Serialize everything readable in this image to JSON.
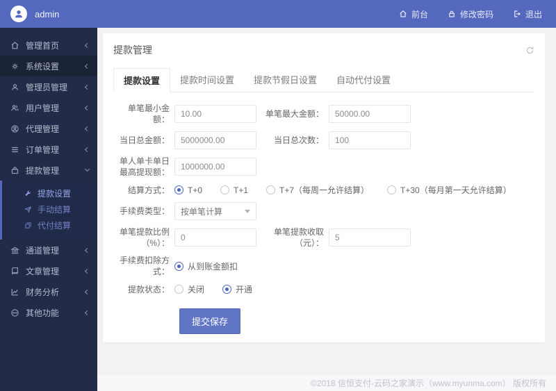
{
  "topbar": {
    "brand": "admin",
    "links": [
      {
        "label": "前台",
        "icon": "home-icon"
      },
      {
        "label": "修改密码",
        "icon": "lock-icon"
      },
      {
        "label": "退出",
        "icon": "signout-icon"
      }
    ]
  },
  "sidebar": {
    "items": [
      {
        "label": "管理首页",
        "icon": "home-icon"
      },
      {
        "label": "系统设置",
        "icon": "gears-icon"
      },
      {
        "label": "管理员管理",
        "icon": "admin-user-icon"
      },
      {
        "label": "用户管理",
        "icon": "users-icon"
      },
      {
        "label": "代理管理",
        "icon": "agent-icon"
      },
      {
        "label": "订单管理",
        "icon": "orders-list-icon"
      },
      {
        "label": "提款管理",
        "icon": "withdraw-bag-icon",
        "expanded": true
      },
      {
        "label": "通道管理",
        "icon": "bank-icon"
      },
      {
        "label": "文章管理",
        "icon": "book-icon"
      },
      {
        "label": "财务分析",
        "icon": "chart-icon"
      },
      {
        "label": "其他功能",
        "icon": "circle-more-icon"
      }
    ],
    "sub": [
      {
        "label": "提款设置",
        "icon": "wrench-icon",
        "active": true
      },
      {
        "label": "手动结算",
        "icon": "send-icon"
      },
      {
        "label": "代付结算",
        "icon": "transfer-icon"
      }
    ]
  },
  "card": {
    "title": "提款管理"
  },
  "tabs": [
    {
      "label": "提款设置",
      "active": true
    },
    {
      "label": "提款时间设置"
    },
    {
      "label": "提款节假日设置"
    },
    {
      "label": "自动代付设置"
    }
  ],
  "form": {
    "min_amount": {
      "label": "单笔最小金额：",
      "value": "10.00"
    },
    "max_amount": {
      "label": "单笔最大金额：",
      "value": "50000.00"
    },
    "daily_total": {
      "label": "当日总金额：",
      "value": "5000000.00"
    },
    "daily_count": {
      "label": "当日总次数：",
      "value": "100"
    },
    "per_card_max": {
      "label": "单人单卡单日最高提现额：",
      "value": "1000000.00"
    },
    "settle_mode": {
      "label": "结算方式：",
      "options": [
        {
          "label": "T+0",
          "selected": true
        },
        {
          "label": "T+1",
          "selected": false
        },
        {
          "label": "T+7（每周一允许结算）",
          "selected": false
        },
        {
          "label": "T+30（每月第一天允许结算）",
          "selected": false
        }
      ]
    },
    "fee_type": {
      "label": "手续费类型：",
      "value": "按单笔计算"
    },
    "fee_percent": {
      "label": "单笔提款比例（%）：",
      "value": "0"
    },
    "fee_fixed": {
      "label": "单笔提款收取（元）：",
      "value": "5"
    },
    "fee_deduct": {
      "label": "手续费扣除方式：",
      "options": [
        {
          "label": "从到账金额扣",
          "selected": true
        }
      ]
    },
    "status": {
      "label": "提款状态：",
      "options": [
        {
          "label": "关闭",
          "selected": false
        },
        {
          "label": "开通",
          "selected": true
        }
      ]
    },
    "submit_label": "提交保存"
  },
  "footer": {
    "copyright": "©2018 信恒支付-云码之家演示（www.myunma.com） 版权所有"
  },
  "colors": {
    "topbar": "#5468be",
    "sidebar": "#222c48",
    "accent": "#4a64c4",
    "button": "#6175c5",
    "main_bg": "#f2f2f2"
  }
}
